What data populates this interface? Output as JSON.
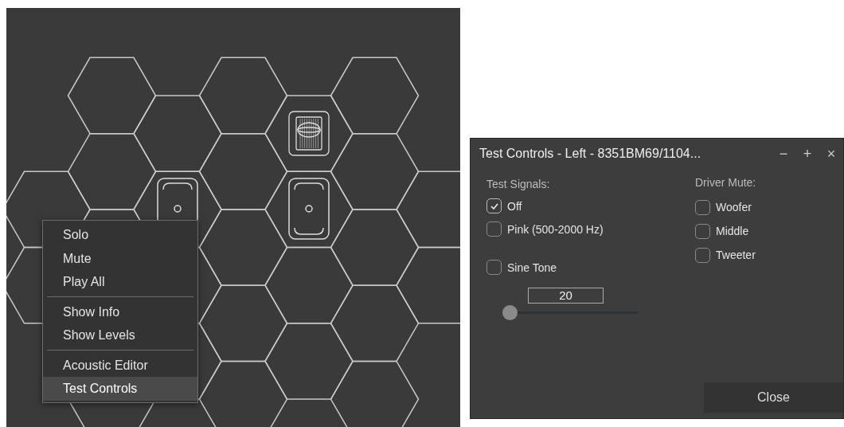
{
  "canvas": {
    "speakers": [
      {
        "kind": "subwoofer"
      },
      {
        "kind": "two_way"
      },
      {
        "kind": "two_way"
      }
    ]
  },
  "context_menu": {
    "groups": [
      [
        {
          "label": "Solo",
          "selected": false
        },
        {
          "label": "Mute",
          "selected": false
        },
        {
          "label": "Play All",
          "selected": false
        }
      ],
      [
        {
          "label": "Show Info",
          "selected": false
        },
        {
          "label": "Show Levels",
          "selected": false
        }
      ],
      [
        {
          "label": "Acoustic Editor",
          "selected": false
        },
        {
          "label": "Test Controls",
          "selected": true
        }
      ]
    ]
  },
  "dialog": {
    "title": "Test Controls - Left - 8351BM69/1104...",
    "window_buttons": [
      "−",
      "+",
      "×"
    ],
    "test_signals": {
      "heading": "Test Signals:",
      "options": [
        {
          "label": "Off",
          "checked": true
        },
        {
          "label": "Pink (500-2000 Hz)",
          "checked": false
        }
      ],
      "sine_tone": {
        "label": "Sine Tone",
        "checked": false
      },
      "frequency": {
        "value": "20",
        "level": 0
      }
    },
    "driver_mute": {
      "heading": "Driver Mute:",
      "drivers": [
        {
          "label": "Woofer",
          "checked": false
        },
        {
          "label": "Middle",
          "checked": false
        },
        {
          "label": "Tweeter",
          "checked": false
        }
      ]
    },
    "close_button": "Close"
  }
}
